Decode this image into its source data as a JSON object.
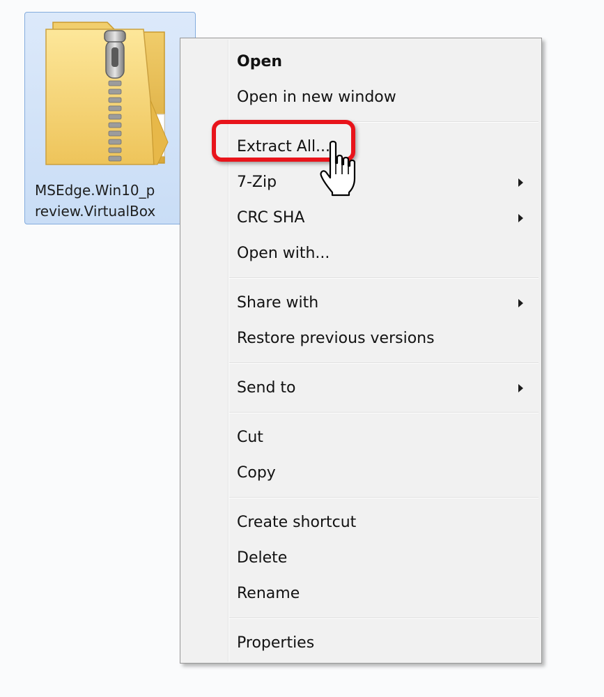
{
  "file": {
    "name_line1": "MSEdge.Win10_p",
    "name_line2": "review.VirtualBox",
    "icon": "zip-folder-icon"
  },
  "menu": {
    "groups": [
      [
        {
          "label": "Open",
          "bold": true
        },
        {
          "label": "Open in new window"
        }
      ],
      [
        {
          "label": "Extract All...",
          "highlighted": true
        },
        {
          "label": "7-Zip",
          "submenu": true
        },
        {
          "label": "CRC SHA",
          "submenu": true
        },
        {
          "label": "Open with..."
        }
      ],
      [
        {
          "label": "Share with",
          "submenu": true
        },
        {
          "label": "Restore previous versions"
        }
      ],
      [
        {
          "label": "Send to",
          "submenu": true
        }
      ],
      [
        {
          "label": "Cut"
        },
        {
          "label": "Copy"
        }
      ],
      [
        {
          "label": "Create shortcut"
        },
        {
          "label": "Delete"
        },
        {
          "label": "Rename"
        }
      ],
      [
        {
          "label": "Properties"
        }
      ]
    ]
  },
  "colors": {
    "highlight": "#e8141b",
    "selection": "#c9ddf6",
    "menu_background": "#f1f1f1"
  },
  "cursor": "hand-pointer-icon"
}
